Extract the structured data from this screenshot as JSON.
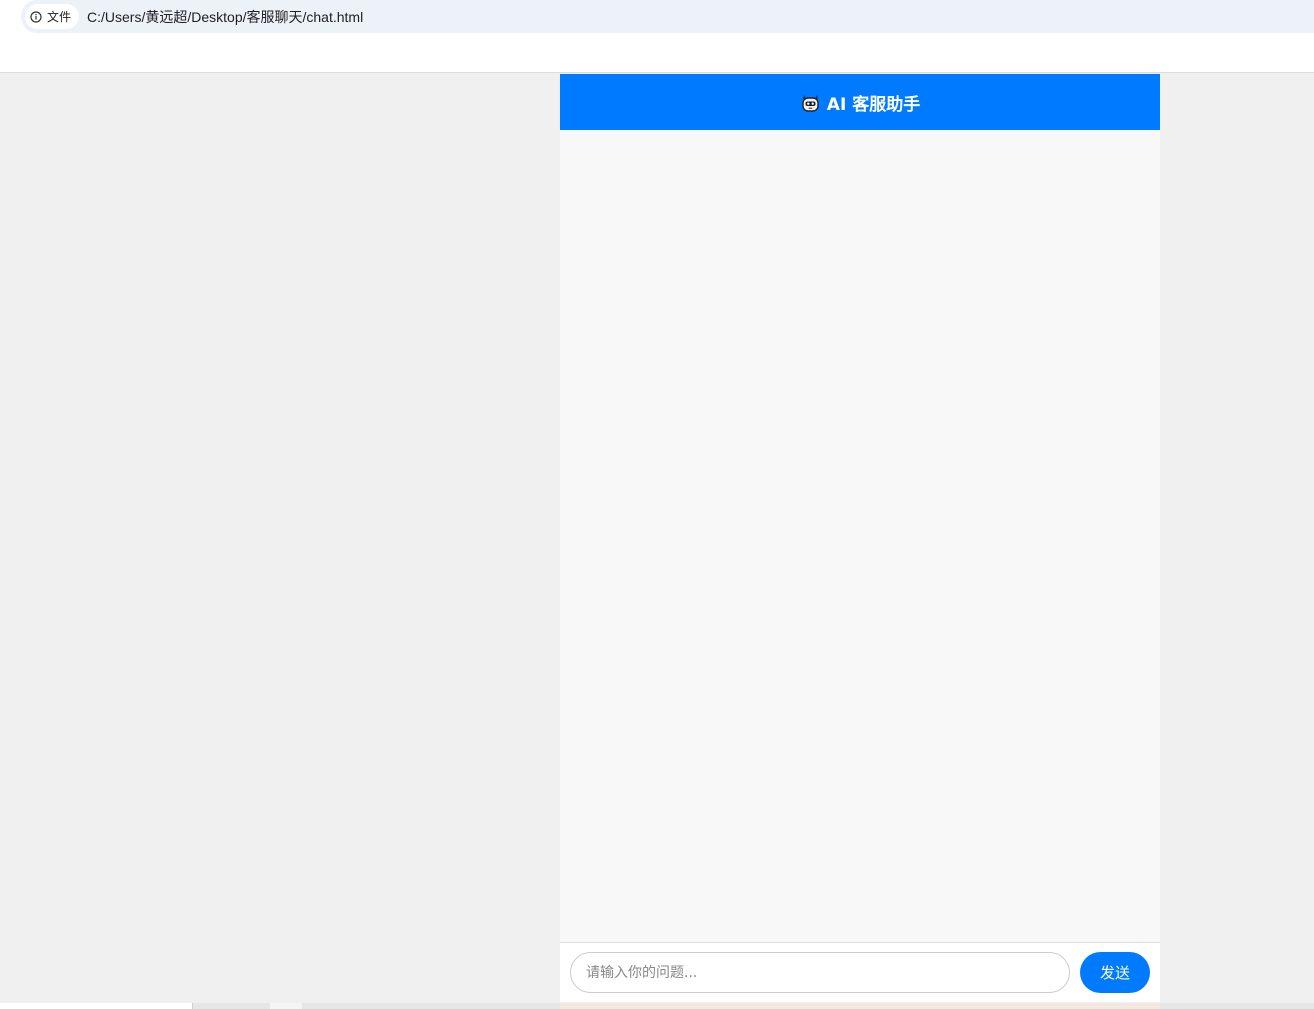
{
  "browser": {
    "site_chip_label": "文件",
    "url": "C:/Users/黄远超/Desktop/客服聊天/chat.html"
  },
  "chat": {
    "header_icon": "robot-face-icon",
    "header_title": "AI 客服助手",
    "input_placeholder": "请输入你的问题...",
    "input_value": "",
    "send_label": "发送"
  },
  "colors": {
    "accent": "#007bff",
    "page_background": "#f0f0f0",
    "chat_background": "#f8f8f8"
  }
}
